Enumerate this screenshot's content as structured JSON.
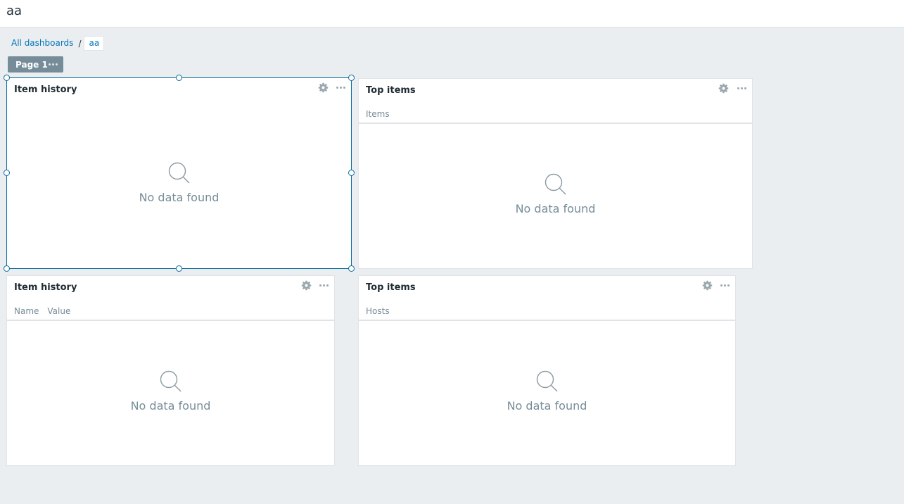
{
  "header": {
    "title": "aa"
  },
  "breadcrumb": {
    "all_dashboards": "All dashboards",
    "separator": "/",
    "current": "aa"
  },
  "pages": [
    {
      "label": "Page 1"
    }
  ],
  "widgets": [
    {
      "title": "Item history",
      "columns": [],
      "empty_text": "No data found"
    },
    {
      "title": "Top items",
      "columns": [
        "Items"
      ],
      "empty_text": "No data found"
    },
    {
      "title": "Item history",
      "columns": [
        "Name",
        "Value"
      ],
      "empty_text": "No data found"
    },
    {
      "title": "Top items",
      "columns": [
        "Hosts"
      ],
      "empty_text": "No data found"
    }
  ],
  "colors": {
    "accent": "#0275b8",
    "selected_border": "#0b6c9e",
    "tab_bg": "#768d99",
    "muted_text": "#768d99"
  },
  "icons": {
    "widget_settings": "gear-icon",
    "widget_menu": "more-dots-icon",
    "empty_state": "magnifier-icon"
  }
}
